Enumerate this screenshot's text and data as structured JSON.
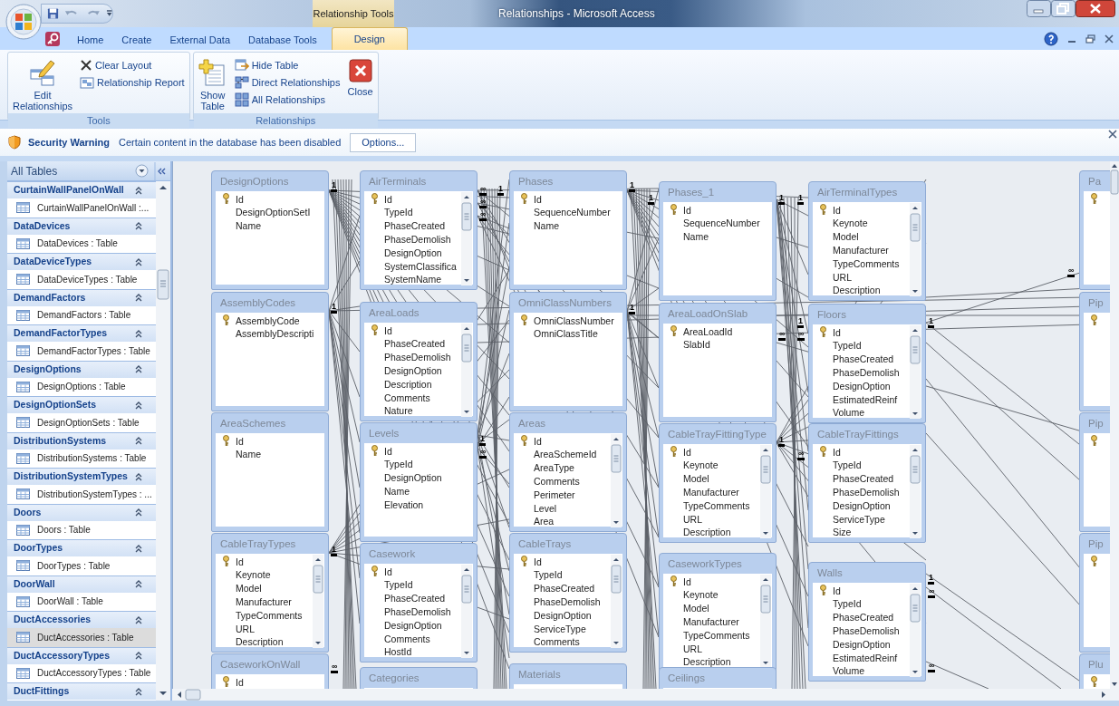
{
  "window": {
    "title": "Relationships - Microsoft Access",
    "context_tab": "Relationship Tools"
  },
  "tabs": [
    {
      "label": "Home",
      "selected": false
    },
    {
      "label": "Create",
      "selected": false
    },
    {
      "label": "External Data",
      "selected": false
    },
    {
      "label": "Database Tools",
      "selected": false
    },
    {
      "label": "Design",
      "selected": true
    }
  ],
  "ribbon_groups": [
    {
      "label": "Tools",
      "buttons": [
        {
          "kind": "large",
          "label": "Edit Relationships"
        },
        {
          "kind": "small",
          "label": "Clear Layout"
        },
        {
          "kind": "small",
          "label": "Relationship Report"
        }
      ]
    },
    {
      "label": "Relationships",
      "buttons": [
        {
          "kind": "large",
          "label": "Show Table"
        },
        {
          "kind": "small",
          "label": "Hide Table"
        },
        {
          "kind": "small",
          "label": "Direct Relationships"
        },
        {
          "kind": "small",
          "label": "All Relationships"
        },
        {
          "kind": "large",
          "label": "Close"
        }
      ]
    }
  ],
  "security_bar": {
    "title": "Security Warning",
    "message": "Certain content in the database has been disabled",
    "button": "Options..."
  },
  "navigation": {
    "title": "All Tables",
    "groups": [
      {
        "name": "CurtainWallPanelOnWall",
        "items": [
          {
            "label": "CurtainWallPanelOnWall :...",
            "selected": false
          }
        ]
      },
      {
        "name": "DataDevices",
        "items": [
          {
            "label": "DataDevices : Table",
            "selected": false
          }
        ]
      },
      {
        "name": "DataDeviceTypes",
        "items": [
          {
            "label": "DataDeviceTypes : Table",
            "selected": false
          }
        ]
      },
      {
        "name": "DemandFactors",
        "items": [
          {
            "label": "DemandFactors : Table",
            "selected": false
          }
        ]
      },
      {
        "name": "DemandFactorTypes",
        "items": [
          {
            "label": "DemandFactorTypes : Table",
            "selected": false
          }
        ]
      },
      {
        "name": "DesignOptions",
        "items": [
          {
            "label": "DesignOptions : Table",
            "selected": false
          }
        ]
      },
      {
        "name": "DesignOptionSets",
        "items": [
          {
            "label": "DesignOptionSets : Table",
            "selected": false
          }
        ]
      },
      {
        "name": "DistributionSystems",
        "items": [
          {
            "label": "DistributionSystems : Table",
            "selected": false
          }
        ]
      },
      {
        "name": "DistributionSystemTypes",
        "items": [
          {
            "label": "DistributionSystemTypes : ...",
            "selected": false
          }
        ]
      },
      {
        "name": "Doors",
        "items": [
          {
            "label": "Doors : Table",
            "selected": false
          }
        ]
      },
      {
        "name": "DoorTypes",
        "items": [
          {
            "label": "DoorTypes : Table",
            "selected": false
          }
        ]
      },
      {
        "name": "DoorWall",
        "items": [
          {
            "label": "DoorWall : Table",
            "selected": false
          }
        ]
      },
      {
        "name": "DuctAccessories",
        "items": [
          {
            "label": "DuctAccessories : Table",
            "selected": true
          }
        ]
      },
      {
        "name": "DuctAccessoryTypes",
        "items": [
          {
            "label": "DuctAccessoryTypes : Table",
            "selected": false
          }
        ]
      },
      {
        "name": "DuctFittings"
      }
    ]
  },
  "tables": [
    {
      "name": "DesignOptions",
      "fields": [
        {
          "name": "Id",
          "key": true
        },
        {
          "name": "DesignOptionSetI",
          "key": false
        },
        {
          "name": "Name",
          "key": false
        }
      ]
    },
    {
      "name": "AssemblyCodes",
      "fields": [
        {
          "name": "AssemblyCode",
          "key": true
        },
        {
          "name": "AssemblyDescripti",
          "key": false
        }
      ]
    },
    {
      "name": "AreaSchemes",
      "fields": [
        {
          "name": "Id",
          "key": true
        },
        {
          "name": "Name",
          "key": false
        }
      ]
    },
    {
      "name": "CableTrayTypes",
      "fields": [
        {
          "name": "Id",
          "key": true
        },
        {
          "name": "Keynote",
          "key": false
        },
        {
          "name": "Model",
          "key": false
        },
        {
          "name": "Manufacturer",
          "key": false
        },
        {
          "name": "TypeComments",
          "key": false
        },
        {
          "name": "URL",
          "key": false
        },
        {
          "name": "Description",
          "key": false
        }
      ]
    },
    {
      "name": "CaseworkOnWall",
      "fields": [
        {
          "name": "Id",
          "key": true
        }
      ]
    },
    {
      "name": "AirTerminals",
      "fields": [
        {
          "name": "Id",
          "key": true
        },
        {
          "name": "TypeId",
          "key": false
        },
        {
          "name": "PhaseCreated",
          "key": false
        },
        {
          "name": "PhaseDemolish",
          "key": false
        },
        {
          "name": "DesignOption",
          "key": false
        },
        {
          "name": "SystemClassifica",
          "key": false
        },
        {
          "name": "SystemName",
          "key": false
        }
      ]
    },
    {
      "name": "AreaLoads",
      "fields": [
        {
          "name": "Id",
          "key": true
        },
        {
          "name": "PhaseCreated",
          "key": false
        },
        {
          "name": "PhaseDemolish",
          "key": false
        },
        {
          "name": "DesignOption",
          "key": false
        },
        {
          "name": "Description",
          "key": false
        },
        {
          "name": "Comments",
          "key": false
        },
        {
          "name": "Nature",
          "key": false
        }
      ]
    },
    {
      "name": "Levels",
      "fields": [
        {
          "name": "Id",
          "key": true
        },
        {
          "name": "TypeId",
          "key": false
        },
        {
          "name": "DesignOption",
          "key": false
        },
        {
          "name": "Name",
          "key": false
        },
        {
          "name": "Elevation",
          "key": false
        }
      ]
    },
    {
      "name": "Casework",
      "fields": [
        {
          "name": "Id",
          "key": true
        },
        {
          "name": "TypeId",
          "key": false
        },
        {
          "name": "PhaseCreated",
          "key": false
        },
        {
          "name": "PhaseDemolish",
          "key": false
        },
        {
          "name": "DesignOption",
          "key": false
        },
        {
          "name": "Comments",
          "key": false
        },
        {
          "name": "HostId",
          "key": false
        }
      ]
    },
    {
      "name": "Categories"
    },
    {
      "name": "Phases",
      "fields": [
        {
          "name": "Id",
          "key": true
        },
        {
          "name": "SequenceNumber",
          "key": false
        },
        {
          "name": "Name",
          "key": false
        }
      ]
    },
    {
      "name": "OmniClassNumbers",
      "fields": [
        {
          "name": "OmniClassNumber",
          "key": true
        },
        {
          "name": "OmniClassTitle",
          "key": false
        }
      ]
    },
    {
      "name": "Areas",
      "fields": [
        {
          "name": "Id",
          "key": true
        },
        {
          "name": "AreaSchemeId",
          "key": false
        },
        {
          "name": "AreaType",
          "key": false
        },
        {
          "name": "Comments",
          "key": false
        },
        {
          "name": "Perimeter",
          "key": false
        },
        {
          "name": "Level",
          "key": false
        },
        {
          "name": "Area",
          "key": false
        }
      ]
    },
    {
      "name": "CableTrays",
      "fields": [
        {
          "name": "Id",
          "key": true
        },
        {
          "name": "TypeId",
          "key": false
        },
        {
          "name": "PhaseCreated",
          "key": false
        },
        {
          "name": "PhaseDemolish",
          "key": false
        },
        {
          "name": "DesignOption",
          "key": false
        },
        {
          "name": "ServiceType",
          "key": false
        },
        {
          "name": "Comments",
          "key": false
        }
      ]
    },
    {
      "name": "Materials"
    },
    {
      "name": "Phases_1",
      "fields": [
        {
          "name": "Id",
          "key": true
        },
        {
          "name": "SequenceNumber",
          "key": false
        },
        {
          "name": "Name",
          "key": false
        }
      ]
    },
    {
      "name": "AreaLoadOnSlab",
      "fields": [
        {
          "name": "AreaLoadId",
          "key": true
        },
        {
          "name": "SlabId",
          "key": false
        }
      ]
    },
    {
      "name": "CableTrayFittingType",
      "fields": [
        {
          "name": "Id",
          "key": true
        },
        {
          "name": "Keynote",
          "key": false
        },
        {
          "name": "Model",
          "key": false
        },
        {
          "name": "Manufacturer",
          "key": false
        },
        {
          "name": "TypeComments",
          "key": false
        },
        {
          "name": "URL",
          "key": false
        },
        {
          "name": "Description",
          "key": false
        }
      ]
    },
    {
      "name": "CaseworkTypes",
      "fields": [
        {
          "name": "Id",
          "key": true
        },
        {
          "name": "Keynote",
          "key": false
        },
        {
          "name": "Model",
          "key": false
        },
        {
          "name": "Manufacturer",
          "key": false
        },
        {
          "name": "TypeComments",
          "key": false
        },
        {
          "name": "URL",
          "key": false
        },
        {
          "name": "Description",
          "key": false
        }
      ]
    },
    {
      "name": "Ceilings"
    },
    {
      "name": "AirTerminalTypes",
      "fields": [
        {
          "name": "Id",
          "key": true
        },
        {
          "name": "Keynote",
          "key": false
        },
        {
          "name": "Model",
          "key": false
        },
        {
          "name": "Manufacturer",
          "key": false
        },
        {
          "name": "TypeComments",
          "key": false
        },
        {
          "name": "URL",
          "key": false
        },
        {
          "name": "Description",
          "key": false
        }
      ]
    },
    {
      "name": "Floors",
      "fields": [
        {
          "name": "Id",
          "key": true
        },
        {
          "name": "TypeId",
          "key": false
        },
        {
          "name": "PhaseCreated",
          "key": false
        },
        {
          "name": "PhaseDemolish",
          "key": false
        },
        {
          "name": "DesignOption",
          "key": false
        },
        {
          "name": "EstimatedReinf",
          "key": false
        },
        {
          "name": "Volume",
          "key": false
        }
      ]
    },
    {
      "name": "CableTrayFittings",
      "fields": [
        {
          "name": "Id",
          "key": true
        },
        {
          "name": "TypeId",
          "key": false
        },
        {
          "name": "PhaseCreated",
          "key": false
        },
        {
          "name": "PhaseDemolish",
          "key": false
        },
        {
          "name": "DesignOption",
          "key": false
        },
        {
          "name": "ServiceType",
          "key": false
        },
        {
          "name": "Size",
          "key": false
        }
      ]
    },
    {
      "name": "Walls",
      "fields": [
        {
          "name": "Id",
          "key": true
        },
        {
          "name": "TypeId",
          "key": false
        },
        {
          "name": "PhaseCreated",
          "key": false
        },
        {
          "name": "PhaseDemolish",
          "key": false
        },
        {
          "name": "DesignOption",
          "key": false
        },
        {
          "name": "EstimatedReinf",
          "key": false
        },
        {
          "name": "Volume",
          "key": false
        }
      ]
    },
    {
      "name": "Pa",
      "fields": [
        {
          "key": true
        }
      ]
    },
    {
      "name": "Pip",
      "fields": [
        {
          "key": true
        }
      ]
    },
    {
      "name": "Pip",
      "fields": [
        {
          "key": true
        }
      ]
    },
    {
      "name": "Pip",
      "fields": [
        {
          "key": true
        }
      ]
    },
    {
      "name": "Plu",
      "fields": [
        {
          "key": true
        }
      ]
    }
  ],
  "join_marks": [
    {
      "symbol": "1"
    },
    {
      "symbol": "1"
    },
    {
      "symbol": "1"
    },
    {
      "symbol": "∞"
    },
    {
      "symbol": "∞"
    },
    {
      "symbol": "∞"
    },
    {
      "symbol": "∞"
    },
    {
      "symbol": "1"
    },
    {
      "symbol": "∞"
    },
    {
      "symbol": "1"
    },
    {
      "symbol": "1"
    },
    {
      "symbol": "1"
    },
    {
      "symbol": "1"
    },
    {
      "symbol": "1"
    },
    {
      "symbol": "1"
    },
    {
      "symbol": "∞"
    },
    {
      "symbol": "1"
    },
    {
      "symbol": "∞"
    },
    {
      "symbol": "1"
    },
    {
      "symbol": "∞"
    },
    {
      "symbol": "1"
    },
    {
      "symbol": "∞"
    },
    {
      "symbol": "1"
    },
    {
      "symbol": "∞"
    },
    {
      "symbol": "∞"
    }
  ]
}
